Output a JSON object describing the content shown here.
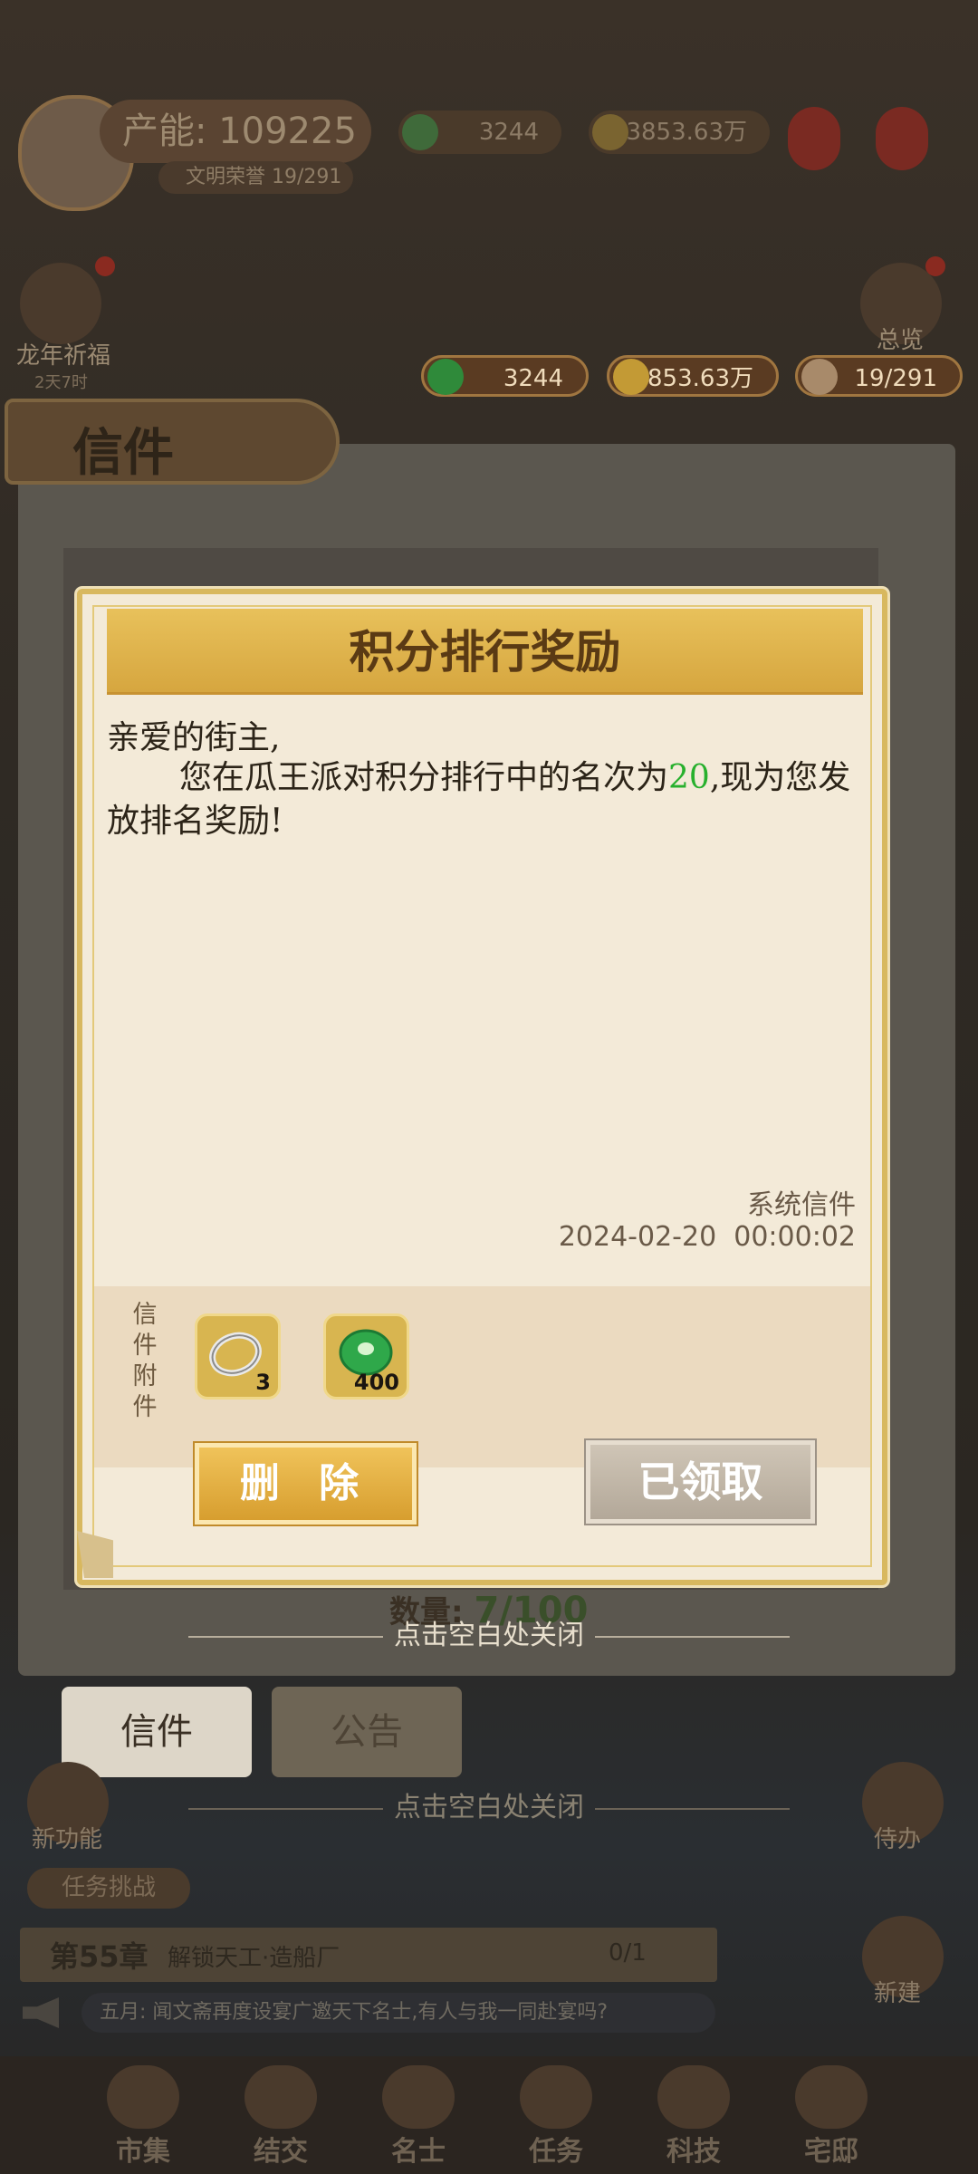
{
  "top": {
    "production_label": "产能:",
    "production_value": "109225",
    "sub_label": "文明荣誉",
    "sub_value": "19/291",
    "jade": "3244",
    "coins": "3853.63万"
  },
  "left_event": {
    "label": "龙年祈福",
    "timer": "2天7时"
  },
  "right_event": {
    "label": "总览"
  },
  "resources": {
    "jade": "3244",
    "coins": "3853.63万",
    "people": "19/291"
  },
  "mail_screen": {
    "title": "信件",
    "count_label": "数量:",
    "count_current": "7",
    "count_max": "/100",
    "close_hint": "点击空白处关闭",
    "tabs": [
      "信件",
      "公告"
    ]
  },
  "modal": {
    "title": "积分排行奖励",
    "greeting": "亲爱的街主,",
    "body_before": "您在瓜王派对积分排行中的名次为",
    "rank": "20",
    "body_after": ",现为您发放排名奖励!",
    "sender": "系统信件",
    "date": "2024-02-20",
    "time": "00:00:02",
    "attach_label": "信件附件",
    "items": [
      {
        "icon": "silver-bracelet-icon",
        "count": "3"
      },
      {
        "icon": "jade-coin-icon",
        "count": "400"
      }
    ],
    "delete_button": "删 除",
    "claimed_button": "已领取"
  },
  "bottom": {
    "new_feature": "新功能",
    "quest_tag": "任务挑战",
    "chapter_num": "第55章",
    "chapter_title": "解锁天工·造船厂",
    "chapter_progress": "0/1",
    "ticker": "五月: 闻文斋再度设宴广邀天下名士,有人与我一同赴宴吗?",
    "right_side": [
      "侍办",
      "新建"
    ],
    "nav": [
      "市集",
      "结交",
      "名士",
      "任务",
      "科技",
      "宅邸"
    ]
  },
  "colors": {
    "rank_green": "#27b02d",
    "title_gold": "#d6a63f",
    "button_gold": "#e0ac3f"
  }
}
